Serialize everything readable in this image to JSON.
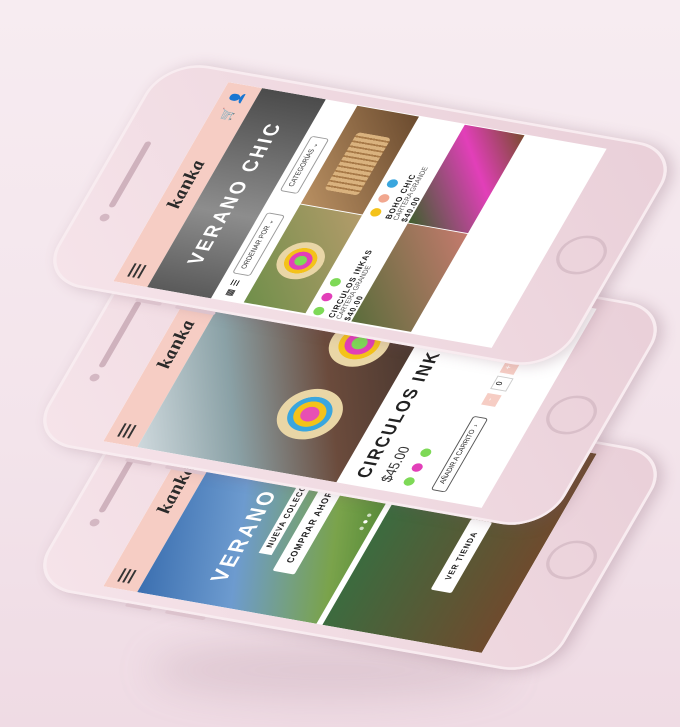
{
  "brand": {
    "logo": "kanka"
  },
  "colors": {
    "header": "#f6cdc4",
    "accent_green": "#7ed957",
    "accent_pink": "#e23fb9",
    "accent_yellow": "#f4c21a",
    "accent_peach": "#f1a78f",
    "accent_blue": "#3aa6de"
  },
  "listing": {
    "banner_title": "VERANO CHIC",
    "sort_label": "ORDENAR POR",
    "category_label": "CATEGORÍAS",
    "products": [
      {
        "name": "CIRCULOS INKAS",
        "subtitle": "CARTERA GRANDE",
        "price": "$40.00",
        "colors": [
          "#7ed957",
          "#e23fb9",
          "#7ed957"
        ]
      },
      {
        "name": "BOHO CHIC",
        "subtitle": "CARTERA GRANDE",
        "price": "$40.00",
        "colors": [
          "#f4c21a",
          "#f1a78f",
          "#3aa6de"
        ]
      }
    ]
  },
  "product": {
    "title": "CIRCULOS INK",
    "price": "$45.00",
    "colors": [
      "#7ed957",
      "#e23fb9",
      "#7ed957"
    ],
    "add_to_cart": "AÑADIR A CARRITO",
    "qty_minus": "-",
    "qty_value": "0",
    "qty_plus": "+"
  },
  "home": {
    "hero_title": "VERANO CHIC",
    "hero_subtitle": "NUEVA COLECCIÓN",
    "hero_cta": "COMPRAR AHORA",
    "shop_cta": "VER TIENDA"
  }
}
